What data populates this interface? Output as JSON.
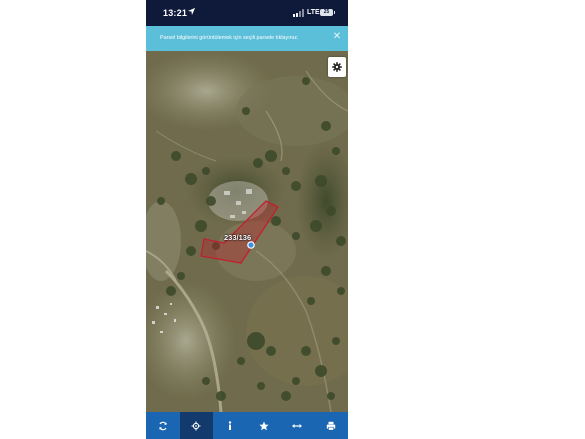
{
  "status_bar": {
    "time": "13:21",
    "network": "LTE",
    "battery": "25",
    "icons": [
      "location-arrow-icon",
      "signal-icon",
      "battery-icon"
    ]
  },
  "banner": {
    "message": "Parsel bilgilerini görüntülemek için seçili parsele tıklayınız.",
    "close_symbol": "✕"
  },
  "map": {
    "parcel_label": "233/136",
    "parcel_color": "#c0202c",
    "location_dot_color": "#3f8fe0"
  },
  "toolbar": {
    "background": "#1b66b3",
    "active_background": "#123a6c",
    "buttons": [
      {
        "icon": "refresh-icon"
      },
      {
        "icon": "crosshair-icon"
      },
      {
        "icon": "info-icon"
      },
      {
        "icon": "star-icon"
      },
      {
        "icon": "measure-icon"
      },
      {
        "icon": "print-icon"
      }
    ]
  }
}
